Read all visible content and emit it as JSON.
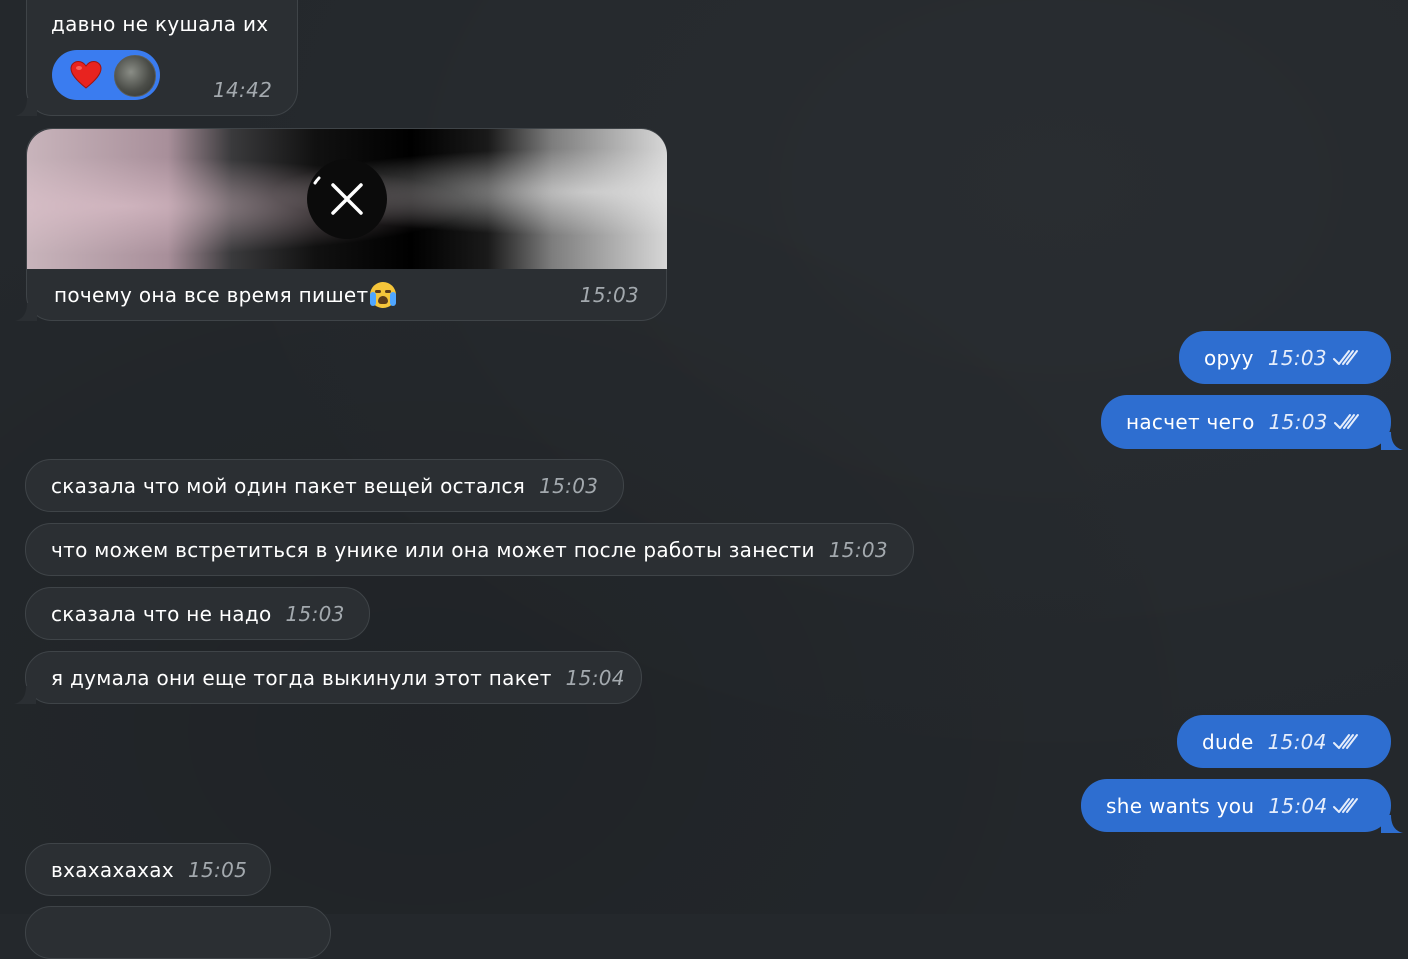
{
  "colors": {
    "background": "#24282c",
    "incoming_bubble": "#2b2f33",
    "outgoing_bubble": "#2e6ed0",
    "reaction_pill": "#3a7cf0"
  },
  "messages": [
    {
      "text": "давно не кушала их",
      "time": "14:42",
      "reactions": [
        "heart-icon",
        "avatar"
      ]
    },
    {
      "text": "почему она все время пишет",
      "emoji": "loudly-crying-face-icon",
      "time": "15:03",
      "media": "blurred-image"
    },
    {
      "text": "оруу",
      "time": "15:03"
    },
    {
      "text": "насчет чего",
      "time": "15:03"
    },
    {
      "text": "сказала что мой один пакет вещей остался",
      "time": "15:03"
    },
    {
      "text": "что можем встретиться в унике или она может после работы занести",
      "time": "15:03"
    },
    {
      "text": "сказала что не надо",
      "time": "15:03"
    },
    {
      "text": "я думала они еще тогда выкинули этот пакет",
      "time": "15:04"
    },
    {
      "text": "dude",
      "time": "15:04"
    },
    {
      "text": "she wants you",
      "time": "15:04"
    },
    {
      "text": "вхахахахах",
      "time": "15:05"
    }
  ]
}
